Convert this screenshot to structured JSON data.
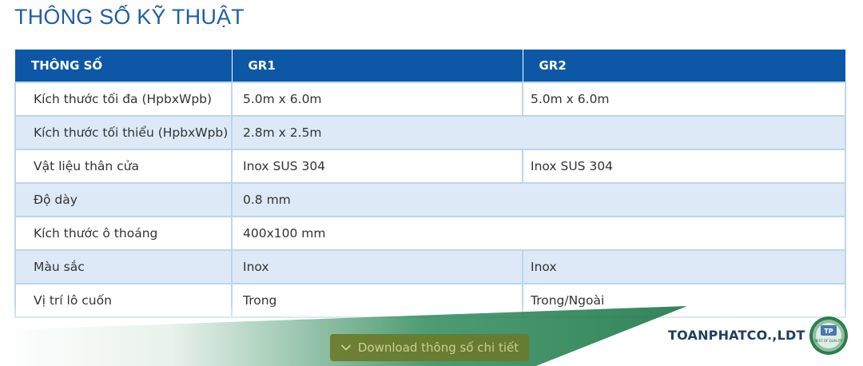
{
  "page": {
    "title": "THÔNG SỐ KỸ THUẬT"
  },
  "table": {
    "headers": [
      "THÔNG SỐ",
      "GR1",
      "GR2"
    ],
    "rows": [
      {
        "label": "Kích thước tối đa (HpbxWpb)",
        "gr1": "5.0m x 6.0m",
        "gr2": "5.0m x 6.0m"
      },
      {
        "label": "Kích thước tối thiểu (HpbxWpb)",
        "gr1": "2.8m x 2.5m",
        "gr2": ""
      },
      {
        "label": "Vật liệu thân cửa",
        "gr1": "Inox SUS 304",
        "gr2": "Inox SUS 304"
      },
      {
        "label": "Độ dày",
        "gr1": "0.8 mm",
        "gr2": ""
      },
      {
        "label": "Kích thước ô thoáng",
        "gr1": "400x100 mm",
        "gr2": ""
      },
      {
        "label": "Màu sắc",
        "gr1": "Inox",
        "gr2": "Inox"
      },
      {
        "label": "Vị trí lô cuốn",
        "gr1": "Trong",
        "gr2": "Trong/Ngoài"
      }
    ]
  },
  "download": {
    "label": "Download thông số chi tiết",
    "icon": "chevron-down-icon"
  },
  "brand": {
    "name": "TOANPHATCO.,LDT",
    "logo_initials": "TP",
    "logo_text": "BEST OF QUALITY"
  },
  "colors": {
    "title": "#1f5fa7",
    "header_bg": "#0d57a7",
    "alt_row_bg": "#dde9f6",
    "border": "#bcd6ea",
    "brand_green": "#0f6f3e"
  }
}
